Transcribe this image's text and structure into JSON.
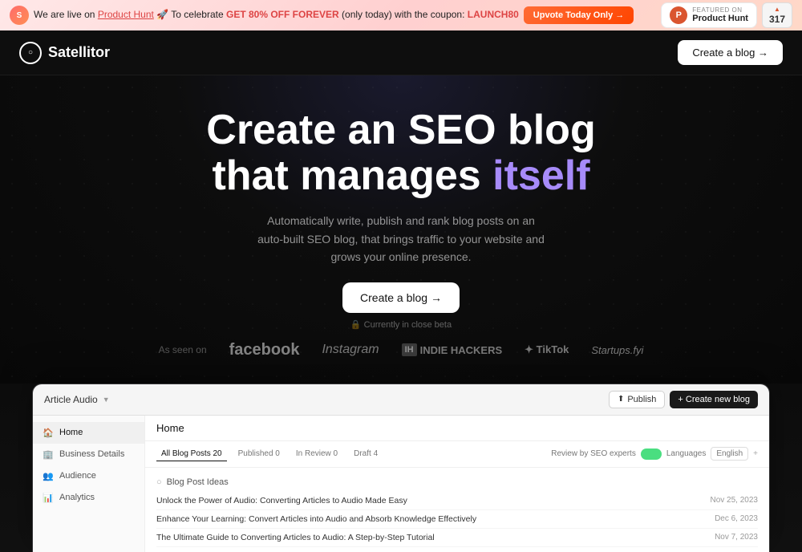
{
  "banner": {
    "avatar_text": "S",
    "main_text": "We are live on ",
    "ph_link": "Product Hunt",
    "celebrate_text": " 🚀 To celebrate ",
    "discount": "GET 80% OFF FOREVER",
    "discount_note": " (only today) with the coupon: ",
    "coupon": "LAUNCH80",
    "upvote_label": "Upvote Today Only →",
    "ph_featured": "FEATURED ON",
    "ph_name": "Product Hunt",
    "ph_arrow": "▲",
    "ph_count": "317"
  },
  "nav": {
    "logo_icon": "○",
    "logo_text": "Satellitor",
    "cta_label": "Create a blog →"
  },
  "hero": {
    "line1": "Create an SEO blog",
    "line2_normal": "that manages ",
    "line2_em": "itself",
    "subtitle": "Automatically write, publish and rank blog posts on an auto-built SEO blog, that brings traffic to your website and grows your online presence.",
    "cta_label": "Create a blog →",
    "beta_note": "🔒 Currently in close beta"
  },
  "as_seen": {
    "label": "As seen on",
    "brands": [
      "facebook",
      "Instagram",
      "IH INDIE HACKERS",
      "TikTok",
      "Startups.fyi"
    ]
  },
  "dashboard": {
    "header_title": "Article Audio",
    "publish_btn": "Publish",
    "new_btn": "+ Create new blog",
    "main_title": "Home",
    "sidebar_items": [
      {
        "icon": "🏠",
        "label": "Home",
        "active": true
      },
      {
        "icon": "🏢",
        "label": "Business Details",
        "active": false
      },
      {
        "icon": "👥",
        "label": "Audience",
        "active": false
      },
      {
        "icon": "📊",
        "label": "Analytics",
        "active": false
      }
    ],
    "filters": {
      "all": "All Blog Posts 20",
      "published": "Published 0",
      "in_review": "In Review 0",
      "draft": "Draft 4",
      "seo_toggle": "Review by SEO experts",
      "lang_label": "Languages",
      "lang_value": "English"
    },
    "section_title": "Blog Post Ideas",
    "posts": [
      {
        "title": "Unlock the Power of Audio: Converting Articles to Audio Made Easy",
        "date": "Nov 25, 2023"
      },
      {
        "title": "Enhance Your Learning: Convert Articles into Audio and Absorb Knowledge Effectively",
        "date": "Dec 6, 2023"
      },
      {
        "title": "The Ultimate Guide to Converting Articles to Audio: A Step-by-Step Tutorial",
        "date": "Nov 7, 2023"
      }
    ]
  }
}
